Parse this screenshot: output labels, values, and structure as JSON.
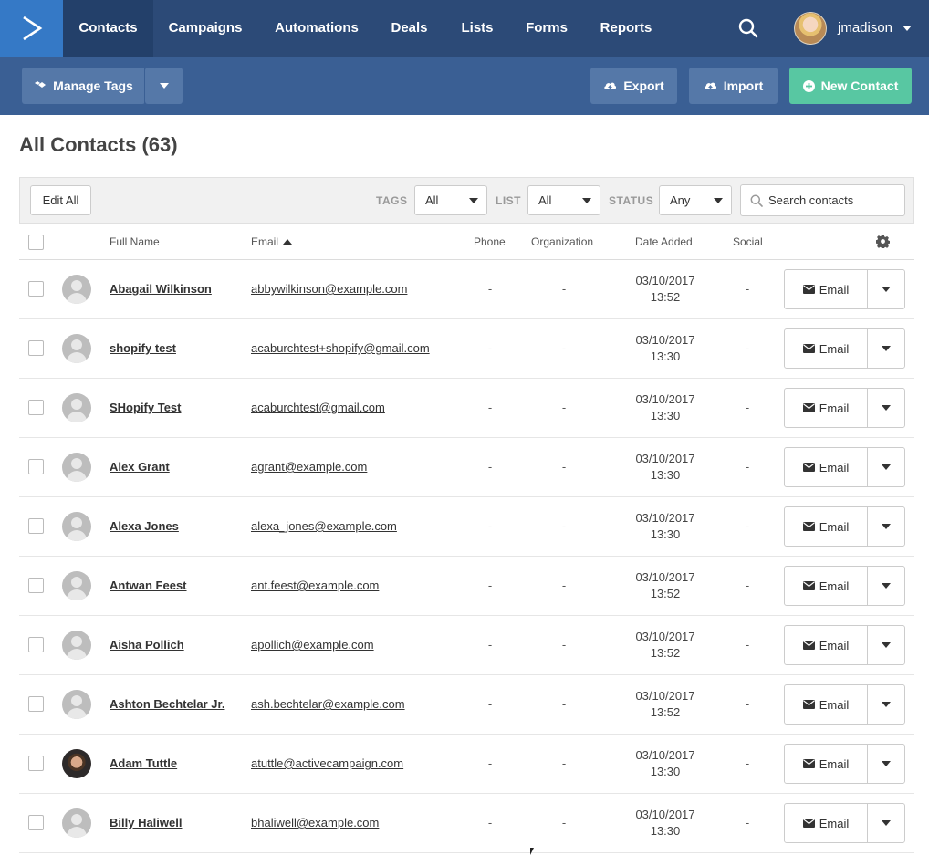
{
  "nav": {
    "items": [
      "Contacts",
      "Campaigns",
      "Automations",
      "Deals",
      "Lists",
      "Forms",
      "Reports"
    ],
    "active": "Contacts",
    "username": "jmadison"
  },
  "toolbar": {
    "manage_tags": "Manage Tags",
    "export": "Export",
    "import": "Import",
    "new_contact": "New Contact"
  },
  "page": {
    "title": "All Contacts (63)"
  },
  "filters": {
    "edit_all": "Edit All",
    "tags_label": "TAGS",
    "tags_value": "All",
    "list_label": "LIST",
    "list_value": "All",
    "status_label": "STATUS",
    "status_value": "Any",
    "search_placeholder": "Search contacts"
  },
  "table": {
    "columns": {
      "full_name": "Full Name",
      "email": "Email",
      "phone": "Phone",
      "organization": "Organization",
      "date_added": "Date Added",
      "social": "Social"
    },
    "action_label": "Email",
    "rows": [
      {
        "name": "Abagail Wilkinson",
        "email": "abbywilkinson@example.com",
        "phone": "-",
        "organization": "-",
        "date": "03/10/2017",
        "time": "13:52",
        "social": "-",
        "avatar": "placeholder"
      },
      {
        "name": "shopify test",
        "email": "acaburchtest+shopify@gmail.com",
        "phone": "-",
        "organization": "-",
        "date": "03/10/2017",
        "time": "13:30",
        "social": "-",
        "avatar": "placeholder"
      },
      {
        "name": "SHopify Test",
        "email": "acaburchtest@gmail.com",
        "phone": "-",
        "organization": "-",
        "date": "03/10/2017",
        "time": "13:30",
        "social": "-",
        "avatar": "placeholder"
      },
      {
        "name": "Alex Grant",
        "email": "agrant@example.com",
        "phone": "-",
        "organization": "-",
        "date": "03/10/2017",
        "time": "13:30",
        "social": "-",
        "avatar": "placeholder"
      },
      {
        "name": "Alexa Jones",
        "email": "alexa_jones@example.com",
        "phone": "-",
        "organization": "-",
        "date": "03/10/2017",
        "time": "13:30",
        "social": "-",
        "avatar": "placeholder"
      },
      {
        "name": "Antwan Feest",
        "email": "ant.feest@example.com",
        "phone": "-",
        "organization": "-",
        "date": "03/10/2017",
        "time": "13:52",
        "social": "-",
        "avatar": "placeholder"
      },
      {
        "name": "Aisha Pollich",
        "email": "apollich@example.com",
        "phone": "-",
        "organization": "-",
        "date": "03/10/2017",
        "time": "13:52",
        "social": "-",
        "avatar": "placeholder"
      },
      {
        "name": "Ashton Bechtelar Jr.",
        "email": "ash.bechtelar@example.com",
        "phone": "-",
        "organization": "-",
        "date": "03/10/2017",
        "time": "13:52",
        "social": "-",
        "avatar": "placeholder"
      },
      {
        "name": "Adam Tuttle",
        "email": "atuttle@activecampaign.com",
        "phone": "-",
        "organization": "-",
        "date": "03/10/2017",
        "time": "13:30",
        "social": "-",
        "avatar": "photo"
      },
      {
        "name": "Billy Haliwell",
        "email": "bhaliwell@example.com",
        "phone": "-",
        "organization": "-",
        "date": "03/10/2017",
        "time": "13:30",
        "social": "-",
        "avatar": "placeholder"
      }
    ]
  },
  "icons": {
    "logo": "chevron-logo-icon",
    "search": "search-icon",
    "tags": "tags-icon",
    "export": "cloud-upload-icon",
    "import": "cloud-upload-icon",
    "new_contact": "plus-circle-icon",
    "settings": "gear-icon",
    "envelope": "envelope-icon"
  },
  "colors": {
    "nav_bg": "#2c4a77",
    "nav_active": "#23406a",
    "logo_bg": "#3579c6",
    "toolbar_bg": "#3a5f94",
    "toolbar_button": "#5578a8",
    "primary_green": "#58c7a2"
  }
}
